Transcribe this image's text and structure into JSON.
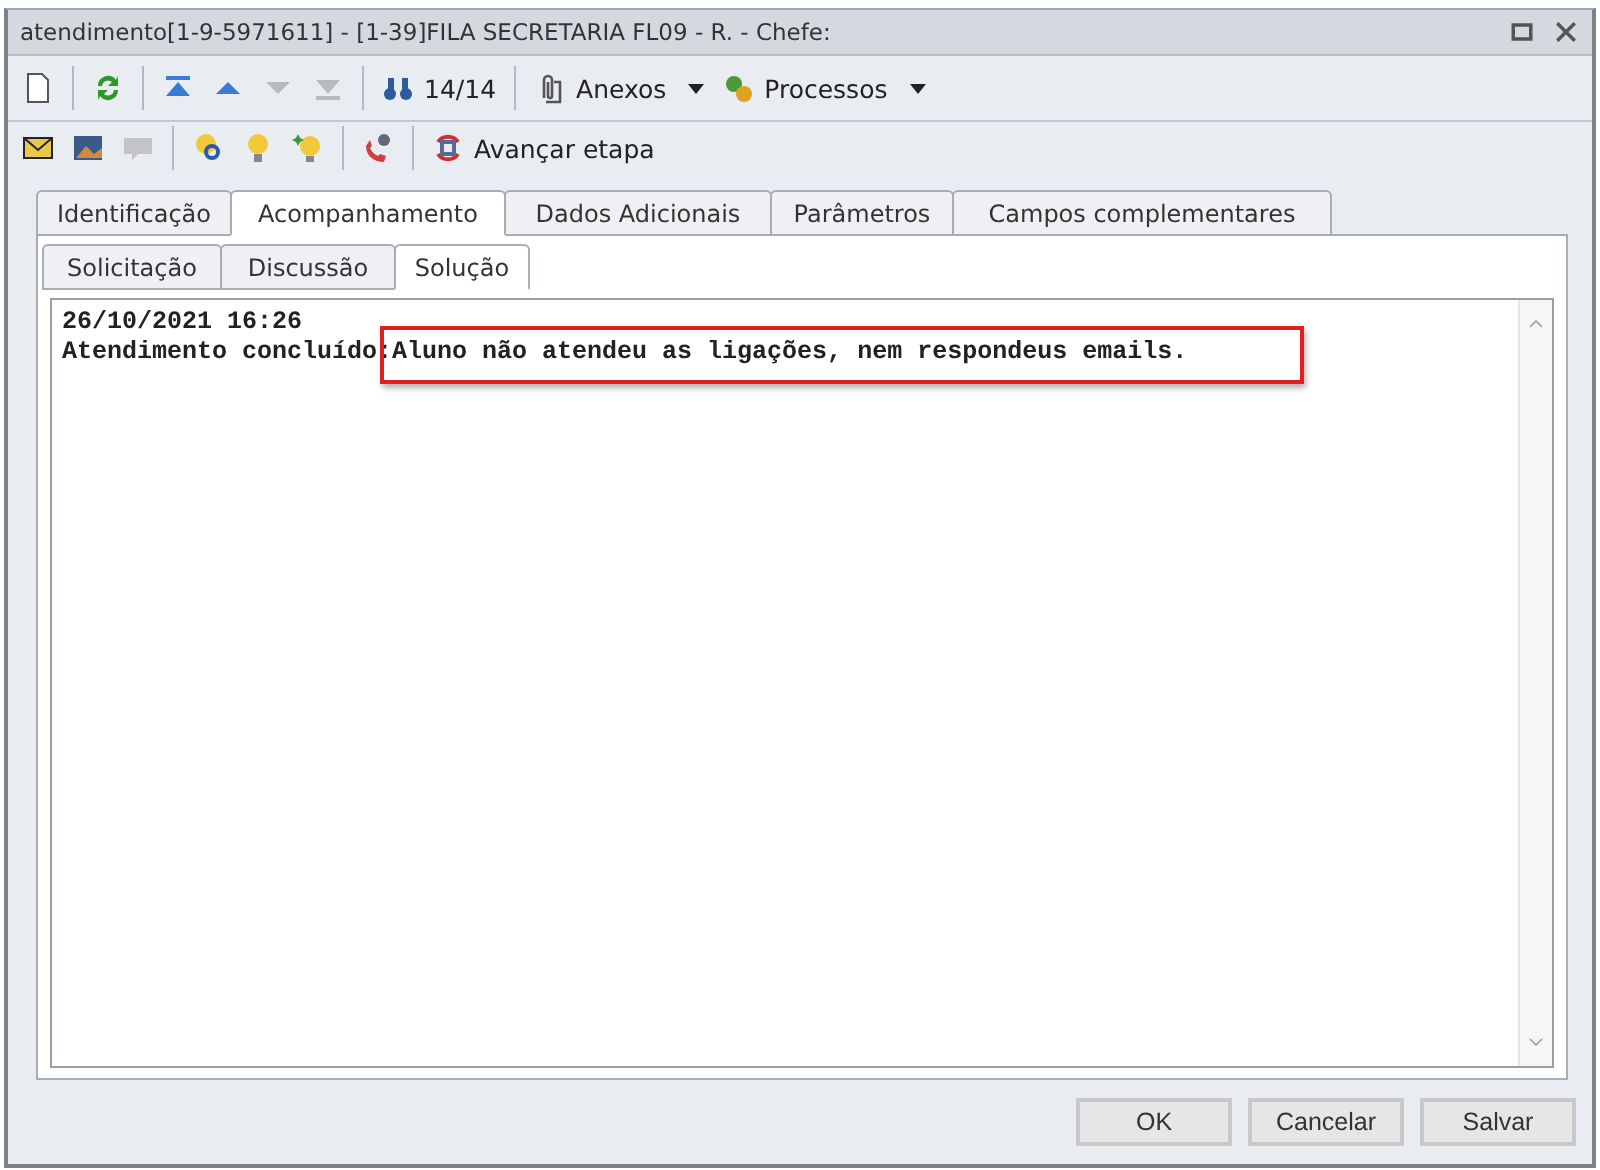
{
  "window": {
    "title": "atendimento[1-9-5971611] - [1-39]FILA SECRETARIA FL09 - R. - Chefe:"
  },
  "toolbar_1": [
    {
      "kind": "button",
      "disabled": false
    },
    {
      "kind": "separator"
    },
    {
      "kind": "button",
      "disabled": false
    },
    {
      "kind": "separator"
    },
    {
      "kind": "button",
      "disabled": false
    },
    {
      "kind": "button",
      "disabled": false
    },
    {
      "kind": "button",
      "disabled": true
    },
    {
      "kind": "button",
      "disabled": true
    },
    {
      "kind": "separator"
    },
    {
      "kind": "labeled",
      "label": "14/14",
      "disabled": false
    },
    {
      "kind": "separator"
    },
    {
      "kind": "menu",
      "label": "Anexos",
      "disabled": false
    },
    {
      "kind": "menu",
      "label": "Processos",
      "disabled": false
    }
  ],
  "toolbar_2": [
    {
      "kind": "button",
      "disabled": false
    },
    {
      "kind": "button",
      "disabled": false
    },
    {
      "kind": "button",
      "disabled": true
    },
    {
      "kind": "separator"
    },
    {
      "kind": "button",
      "disabled": false
    },
    {
      "kind": "button",
      "disabled": false
    },
    {
      "kind": "button",
      "disabled": false
    },
    {
      "kind": "separator"
    },
    {
      "kind": "button",
      "disabled": false
    },
    {
      "kind": "separator"
    },
    {
      "kind": "labeled",
      "label": "Avançar etapa",
      "disabled": false
    }
  ],
  "tabs": [
    {
      "label": "Identificação",
      "selected": false
    },
    {
      "label": "Acompanhamento",
      "selected": true
    },
    {
      "label": "Dados Adicionais",
      "selected": false
    },
    {
      "label": "Parâmetros",
      "selected": false
    },
    {
      "label": "Campos complementares",
      "selected": false
    }
  ],
  "subtabs": [
    {
      "label": "Solicitação",
      "selected": false
    },
    {
      "label": "Discussão",
      "selected": false
    },
    {
      "label": "Solução",
      "selected": true
    }
  ],
  "text_area": {
    "lines": [
      "26/10/2021 16:26",
      "Atendimento concluído:Aluno não atendeu as ligações, nem respondeus emails."
    ],
    "highlighted": true
  },
  "buttons": [
    "OK",
    "Cancelar",
    "Salvar"
  ]
}
